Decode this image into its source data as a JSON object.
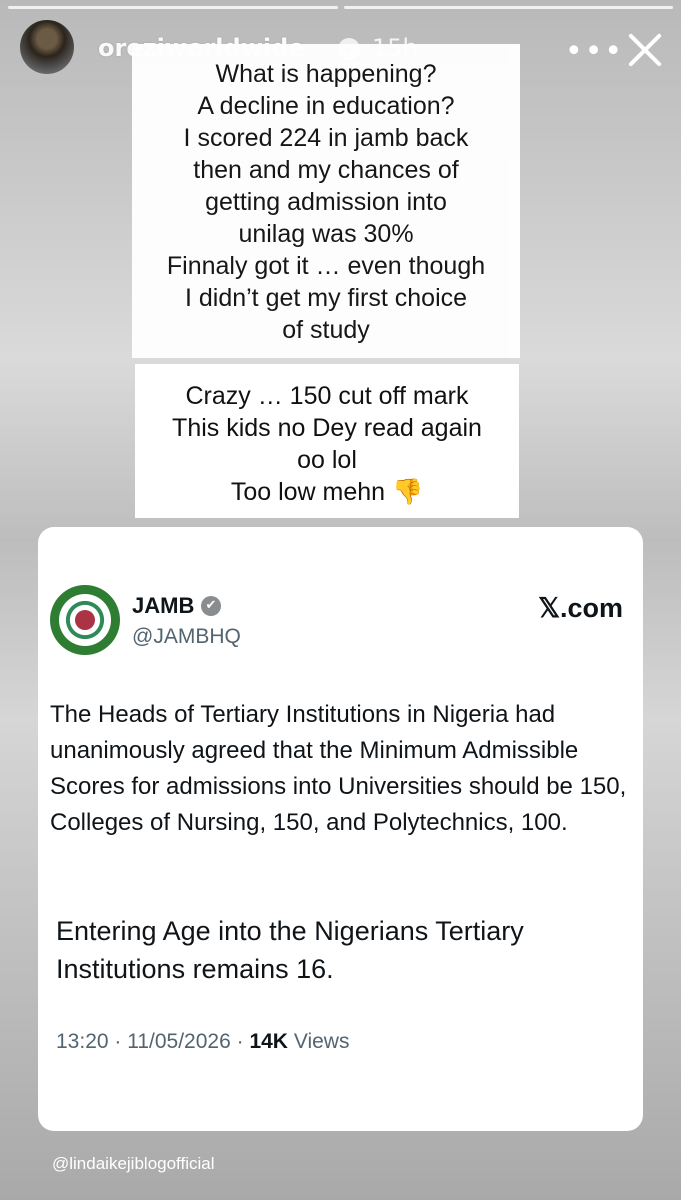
{
  "story": {
    "progress_segments": 2,
    "username": "oreziworldwide",
    "verified_glyph": "✔",
    "age": "15h",
    "more_icon": "ellipsis-icon",
    "close_icon": "close-icon"
  },
  "note1": {
    "lines": [
      "What is happening?",
      "A decline in education?",
      "I scored 224 in jamb back",
      "then and my chances of",
      "getting admission into",
      "unilag was 30%",
      "Finnaly got it … even though",
      "I didn’t get my first choice",
      "of study"
    ]
  },
  "note2": {
    "lines": [
      "Crazy … 150 cut off mark",
      "This kids no Dey read again",
      "oo lol",
      "Too low mehn 👎"
    ]
  },
  "tweet": {
    "name": "JAMB",
    "verified_glyph": "✔",
    "handle": "@JAMBHQ",
    "source": "𝕏.com",
    "paragraph1": "The Heads of Tertiary Institutions in Nigeria had unanimously agreed that the Minimum Admissible Scores for admissions into Universities should be 150, Colleges of Nursing, 150, and Polytechnics, 100.",
    "paragraph2": "Entering Age into the Nigerians Tertiary Institutions remains 16.",
    "time": "13:20",
    "sep1": " · ",
    "date": "11/05/2026",
    "sep2": " · ",
    "views": "14K",
    "views_label": " Views"
  },
  "credit": "@lindaikejiblogofficial"
}
